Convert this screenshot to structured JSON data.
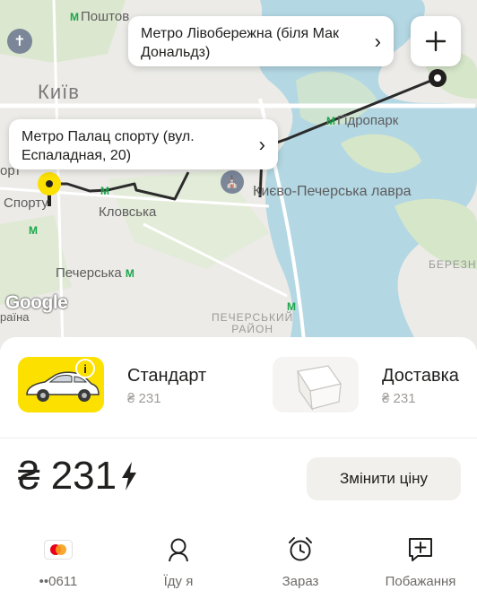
{
  "map": {
    "labels": {
      "post_office": "Поштов",
      "city": "Київ",
      "hidropark": "Гідропарк",
      "lavra": "Києво-Печерська лавра",
      "sportu_top": "орт",
      "sportu": "Спорту",
      "klovska": "Кловська",
      "pecherska": "Печерська",
      "pechersky_rayon_1": "ПЕЧЕРСЬКИЙ",
      "pechersky_rayon_2": "РАЙОН",
      "berezniaky": "БЕРЕЗН",
      "ukraina": "раїна"
    },
    "destination": "Метро Лівобережна (біля Мак Дональдз)",
    "origin": "Метро Палац спорту (вул. Еспаладная, 20)",
    "google_logo": "Google"
  },
  "tariffs": [
    {
      "name": "Стандарт",
      "price": "₴ 231",
      "info_badge": "i",
      "image": "car-icon"
    },
    {
      "name": "Доставка",
      "price": "₴ 231",
      "image": "parcel-icon"
    }
  ],
  "order": {
    "price": "₴ 231",
    "change_price_label": "Змінити ціну"
  },
  "bottom_bar": {
    "payment": "••0611",
    "passenger": "Їду я",
    "time": "Зараз",
    "wishes": "Побажання"
  },
  "colors": {
    "accent": "#fce000",
    "metro": "#1aa64b",
    "route": "#2b2b2b",
    "water": "#b3d7e3",
    "park": "#d6e6c9"
  }
}
